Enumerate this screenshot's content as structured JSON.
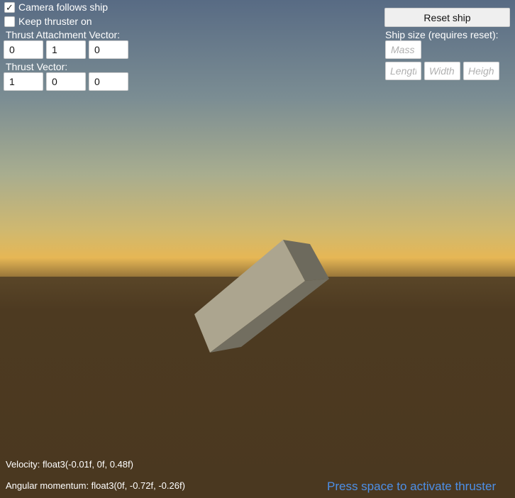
{
  "options": {
    "camera_follows_ship": {
      "label": "Camera follows ship",
      "checked": true
    },
    "keep_thruster_on": {
      "label": "Keep thruster on",
      "checked": false
    }
  },
  "thrust_attachment": {
    "label": "Thrust Attachment Vector:",
    "x": "0",
    "y": "1",
    "z": "0"
  },
  "thrust_vector": {
    "label": "Thrust Vector:",
    "x": "1",
    "y": "0",
    "z": "0"
  },
  "ship": {
    "reset_label": "Reset ship",
    "size_label": "Ship size (requires reset):",
    "mass_placeholder": "Mass",
    "length_placeholder": "Length",
    "width_placeholder": "Width",
    "height_placeholder": "Height"
  },
  "status": {
    "velocity": "Velocity: float3(-0.01f, 0f, 0.48f)",
    "angular_momentum": "Angular momentum: float3(0f, -0.72f, -0.26f)",
    "hint": "Press space to activate thruster"
  },
  "colors": {
    "sky_top": "#586b84",
    "horizon_glow": "#e6b755",
    "ground": "#4a3820",
    "box_top": "#aca58f",
    "box_side": "#6d6a5d",
    "hint": "#4d8fe6",
    "checkmark": "check-icon"
  }
}
